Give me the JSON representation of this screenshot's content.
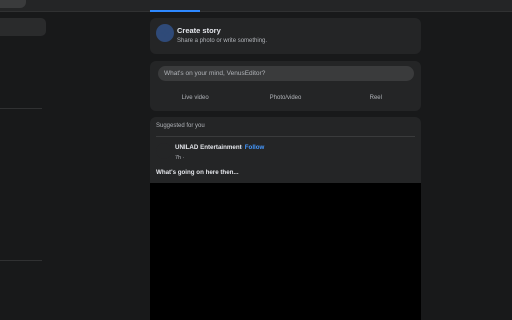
{
  "colors": {
    "page_background": "#18191a",
    "card_background": "#242526",
    "input_background": "#3a3b3c",
    "accent": "#2d88ff",
    "link": "#4599ff",
    "video_background": "#000000"
  },
  "create_story": {
    "icon": "plus-icon",
    "title": "Create story",
    "subtitle": "Share a photo or write something."
  },
  "composer": {
    "placeholder": "What's on your mind, VenusEditor?",
    "actions": [
      {
        "label": "Live video"
      },
      {
        "label": "Photo/video"
      },
      {
        "label": "Reel"
      }
    ]
  },
  "suggested": {
    "header": "Suggested for you",
    "page_name": "UNILAD Entertainment",
    "follow_label": "· Follow",
    "time": "7h ·",
    "post_text": "What's going on here then..."
  }
}
